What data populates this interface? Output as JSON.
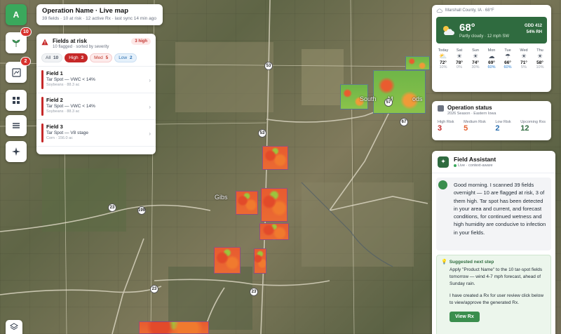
{
  "header": {
    "title": "Operation Name · Live map",
    "subtitle": "39 fields · 10 at risk · 12 active Rx · last sync 14 min ago"
  },
  "rail": {
    "avatar_letter": "A",
    "badge_fields": "10",
    "badge_alerts": "2"
  },
  "risk_panel": {
    "title": "Fields at risk",
    "subtitle": "10 flagged · sorted by severity",
    "count_badge": "3 high",
    "filters": [
      {
        "label": "All",
        "count": "10"
      },
      {
        "label": "High",
        "count": "3"
      },
      {
        "label": "Med",
        "count": "5"
      },
      {
        "label": "Low",
        "count": "2"
      }
    ],
    "fields": [
      {
        "name": "Field 1",
        "issue": "Tar Spot — VWC < 14%",
        "meta": "Soybeans · 88.3 ac"
      },
      {
        "name": "Field 2",
        "issue": "Tar Spot — VWC < 14%",
        "meta": "Soybeans · 88.3 ac"
      },
      {
        "name": "Field 3",
        "issue": "Tar Spot — V8 stage",
        "meta": "Corn · 156.0 ac"
      }
    ]
  },
  "map": {
    "towns": [
      "South",
      "M",
      "ods",
      "Gibs"
    ],
    "route_shields": [
      "53",
      "53",
      "57",
      "67",
      "23",
      "199",
      "23",
      "23"
    ]
  },
  "weather": {
    "location": "Marshall County, IA · 68°F",
    "temp": "68°",
    "condition": "Partly cloudy · 12 mph SW",
    "gdd": "GDD 412",
    "rh": "54% RH",
    "days": [
      {
        "day": "Today",
        "icon": "partly-cloudy-icon",
        "temp": "72°",
        "precip": "10%",
        "wet": false
      },
      {
        "day": "Sat",
        "icon": "sun-icon",
        "temp": "78°",
        "precip": "0%",
        "wet": false
      },
      {
        "day": "Sun",
        "icon": "sun-icon",
        "temp": "74°",
        "precip": "30%",
        "wet": false
      },
      {
        "day": "Mon",
        "icon": "cloud-icon",
        "temp": "69°",
        "precip": "60%",
        "wet": true
      },
      {
        "day": "Tue",
        "icon": "rain-icon",
        "temp": "66°",
        "precip": "60%",
        "wet": true
      },
      {
        "day": "Wed",
        "icon": "sun-icon",
        "temp": "71°",
        "precip": "5%",
        "wet": false
      },
      {
        "day": "Thu",
        "icon": "sun-icon",
        "temp": "58°",
        "precip": "10%",
        "wet": false
      }
    ]
  },
  "status": {
    "title": "Operation status",
    "subtitle": "2026 Season · Eastern Iowa",
    "cells": [
      {
        "label": "High Risk",
        "value": "3",
        "color": "#c62828"
      },
      {
        "label": "Medium Risk",
        "value": "5",
        "color": "#e5602f"
      },
      {
        "label": "Low Risk",
        "value": "2",
        "color": "#2a6fb0"
      },
      {
        "label": "Upcoming Rxs",
        "value": "12",
        "color": "#2f6b3f"
      }
    ]
  },
  "assistant": {
    "title": "Field Assistant",
    "live": "Live · context-aware",
    "message": "Good morning. I scanned 39 fields overnight — 10 are flagged at risk, 3 of them high. Tar spot has been detected in your area and current, and forecast conditions, for continued wetness and high humidity are conducive to infection in your fields.",
    "step_title": "Suggested next step",
    "step_text": "Apply \"Product Name\" to the 10 tar-spot fields tomorrow — wind 4-7 mph forecast, ahead of Sunday rain.",
    "step_text2": "I have created a Rx for user review click below to view/approve the generated Rx.",
    "button": "View Rx"
  }
}
